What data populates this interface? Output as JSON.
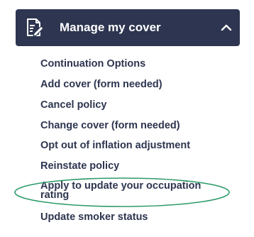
{
  "panel": {
    "title": "Manage my cover",
    "header_icon": "edit-document-icon",
    "toggle_icon": "chevron-up-icon",
    "header_color": "#2d3550",
    "link_color": "#2d3550"
  },
  "menu": {
    "items": [
      {
        "label": "Continuation Options"
      },
      {
        "label": "Add cover (form needed)"
      },
      {
        "label": "Cancel policy"
      },
      {
        "label": "Change cover (form needed)"
      },
      {
        "label": "Opt out of inflation adjustment"
      },
      {
        "label": "Reinstate policy"
      },
      {
        "label": "Apply to update your occupation rating"
      },
      {
        "label": "Update smoker status"
      }
    ]
  },
  "annotation": {
    "shape": "ellipse",
    "color": "#2e9b6a",
    "highlighted_item": "Apply to update your occupation rating"
  }
}
